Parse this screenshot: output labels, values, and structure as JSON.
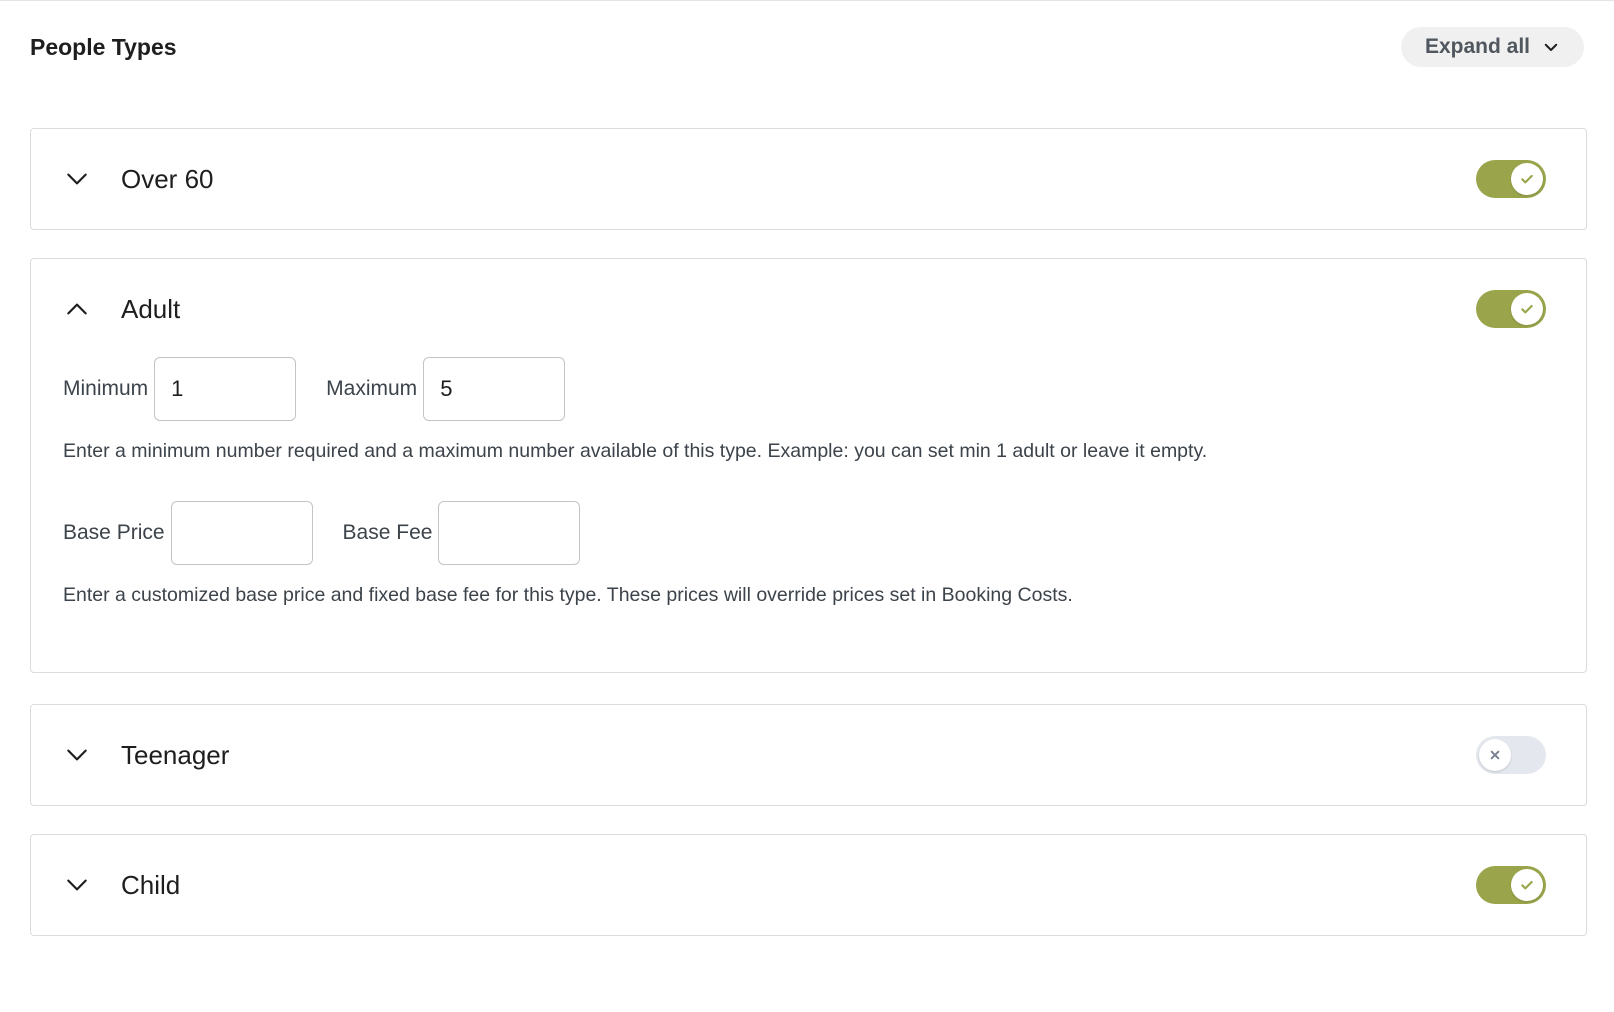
{
  "header": {
    "title": "People Types",
    "expand_label": "Expand all"
  },
  "colors": {
    "toggle_on": "#9aa54b",
    "toggle_off": "#e4e8ee"
  },
  "people_types": [
    {
      "name": "Over 60",
      "expanded": false,
      "enabled": true
    },
    {
      "name": "Adult",
      "expanded": true,
      "enabled": true
    },
    {
      "name": "Teenager",
      "expanded": false,
      "enabled": false
    },
    {
      "name": "Child",
      "expanded": false,
      "enabled": true
    }
  ],
  "adult_details": {
    "minimum_label": "Minimum",
    "minimum_value": "1",
    "maximum_label": "Maximum",
    "maximum_value": "5",
    "min_max_help": "Enter a minimum number required and a maximum number available of this type. Example: you can set min 1 adult or leave it empty.",
    "base_price_label": "Base Price",
    "base_price_value": "",
    "base_fee_label": "Base Fee",
    "base_fee_value": "",
    "price_help": "Enter a customized base price and fixed base fee for this type. These prices will override prices set in Booking Costs."
  },
  "icons": {
    "expand": "chevron-down-icon",
    "collapsed": "chevron-down-icon",
    "expanded": "chevron-up-icon",
    "toggle_on": "check-icon",
    "toggle_off": "x-icon"
  }
}
